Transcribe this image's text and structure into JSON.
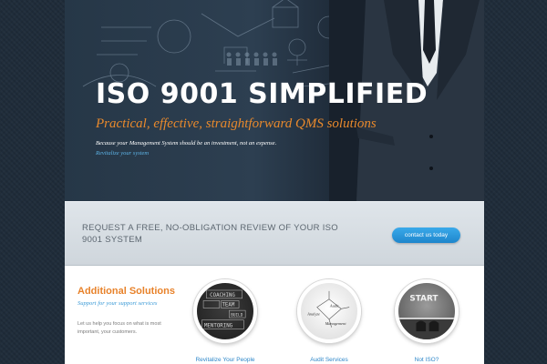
{
  "hero": {
    "title": "ISO 9001 SIMPLIFIED",
    "subtitle": "Practical, effective, straightforward QMS solutions",
    "note": "Because your Management System should be an investment, not an expense.",
    "link": "Revitalize your system"
  },
  "cta": {
    "text": "REQUEST A FREE, NO-OBLIGATION REVIEW OF YOUR ISO 9001 SYSTEM",
    "button": "contact us today"
  },
  "solutions": {
    "heading": "Additional Solutions",
    "tagline": "Support for your support services",
    "description": "Let us help you focus on what is most important, your customers.",
    "items": [
      {
        "label": "Revitalize Your People",
        "image_words": [
          "COACHING",
          "TEAM",
          "BUILD",
          "MENTORING"
        ]
      },
      {
        "label": "Audit Services",
        "image_words": [
          "Analyze",
          "Audit",
          "Management"
        ]
      },
      {
        "label": "Not ISO?",
        "image_words": [
          "START"
        ]
      }
    ]
  },
  "colors": {
    "accent_orange": "#e8892c",
    "link_blue": "#2d87c9",
    "button_blue": "#1e86cc",
    "hero_dark": "#263747"
  }
}
